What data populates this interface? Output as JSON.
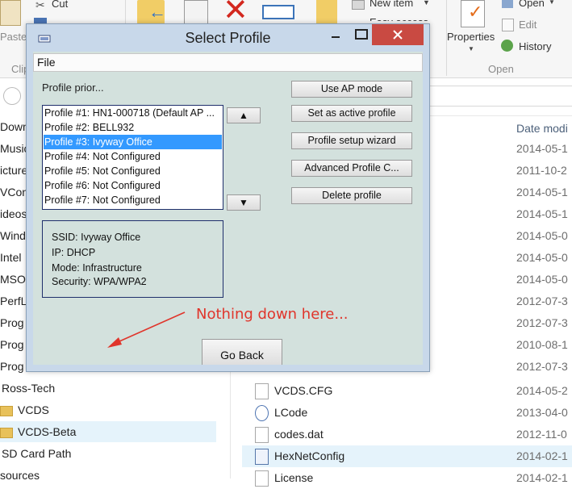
{
  "ribbon": {
    "cut": "Cut",
    "paste": "Paste",
    "clipboard_group": "Clip",
    "new_item": "New item",
    "easy_access": "Easy access",
    "properties": "Properties",
    "open": "Open",
    "edit": "Edit",
    "history": "History",
    "open_group": "Open"
  },
  "nav": {
    "items": [
      {
        "label": "Downl"
      },
      {
        "label": "Music"
      },
      {
        "label": "icture"
      },
      {
        "label": "VCon"
      },
      {
        "label": "ideos"
      },
      {
        "label": "Windo"
      },
      {
        "label": "Intel"
      },
      {
        "label": "MSO"
      },
      {
        "label": "PerfL"
      },
      {
        "label": "Prog"
      },
      {
        "label": "Prog"
      },
      {
        "label": "Prog"
      },
      {
        "label": "Ross-Tech"
      },
      {
        "label": "VCDS"
      },
      {
        "label": "VCDS-Beta"
      },
      {
        "label": "SD Card Path"
      },
      {
        "label": "sources"
      }
    ]
  },
  "files": {
    "date_header": "Date modi",
    "dates": [
      "2014-05-1",
      "2011-10-2",
      "2014-05-1",
      "2014-05-1",
      "2014-05-0",
      "2014-05-0",
      "2014-05-0",
      "2012-07-3",
      "2012-07-3",
      "2010-08-1",
      "2012-07-3"
    ],
    "rows": [
      {
        "name": "VCDS.CFG",
        "date": "2014-05-2"
      },
      {
        "name": "LCode",
        "date": "2013-04-0"
      },
      {
        "name": "codes.dat",
        "date": "2012-11-0"
      },
      {
        "name": "HexNetConfig",
        "date": "2014-02-1"
      },
      {
        "name": "License",
        "date": "2014-02-1"
      }
    ]
  },
  "dialog": {
    "title": "Select Profile",
    "menu_file": "File",
    "priority_label": "Profile prior...",
    "profiles": [
      "Profile #1: HN1-000718 (Default AP ...",
      "Profile #2: BELL932",
      "Profile #3: Ivyway Office",
      "Profile #4: Not Configured",
      "Profile #5: Not Configured",
      "Profile #6: Not Configured",
      "Profile #7: Not Configured"
    ],
    "selected_index": 2,
    "move_up": "▲",
    "move_down": "▼",
    "info": {
      "ssid": "SSID: Ivyway Office",
      "ip": "IP: DHCP",
      "mode": "Mode: Infrastructure",
      "security": "Security: WPA/WPA2"
    },
    "buttons": {
      "ap_mode": "Use AP mode",
      "set_active": "Set as active profile",
      "wizard": "Profile setup wizard",
      "advanced": "Advanced Profile C...",
      "delete": "Delete profile",
      "go_back": "Go Back"
    }
  },
  "annotation": {
    "text": "Nothing down here...",
    "color": "#e0352b"
  }
}
